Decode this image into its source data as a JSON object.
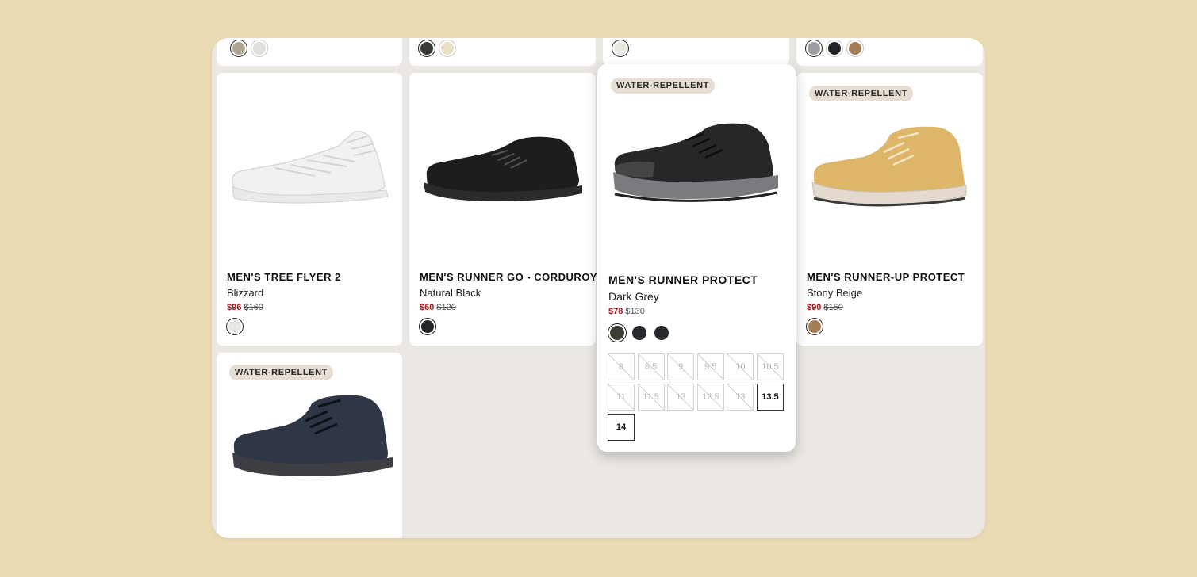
{
  "colors": {
    "page_bg": "#eadbb5",
    "panel_bg": "#ebe8e3",
    "sale_price": "#a4161a",
    "badge_bg": "#e6ded2"
  },
  "top_row": [
    {
      "swatches": [
        "#b1a594",
        "#e2e0dc"
      ]
    },
    {
      "swatches": [
        "#3b3b35",
        "#e8dfc6"
      ]
    },
    {
      "swatches": [
        "#e9ebe3"
      ]
    },
    {
      "swatches": [
        "#9d9ea3",
        "#1f2227",
        "#a47c56"
      ]
    }
  ],
  "products": [
    {
      "title": "MEN'S TREE FLYER 2",
      "color": "Blizzard",
      "sale_price": "$96",
      "original_price": "$160",
      "swatches": [
        "#e6e6e3"
      ]
    },
    {
      "title": "MEN'S RUNNER GO - CORDUROY",
      "color": "Natural Black",
      "sale_price": "$60",
      "original_price": "$120",
      "swatches": [
        "#23262a"
      ]
    },
    {
      "badge": "WATER-REPELLENT",
      "title": "MEN'S RUNNER PROTECT",
      "color": "Dark Grey",
      "sale_price": "$78",
      "original_price": "$130",
      "swatches": [
        "#3b3d35",
        "#25282c",
        "#25282c"
      ],
      "sizes": [
        {
          "label": "8",
          "available": false
        },
        {
          "label": "8.5",
          "available": false
        },
        {
          "label": "9",
          "available": false
        },
        {
          "label": "9.5",
          "available": false
        },
        {
          "label": "10",
          "available": false
        },
        {
          "label": "10.5",
          "available": false
        },
        {
          "label": "11",
          "available": false
        },
        {
          "label": "11.5",
          "available": false
        },
        {
          "label": "12",
          "available": false
        },
        {
          "label": "12.5",
          "available": false
        },
        {
          "label": "13",
          "available": false
        },
        {
          "label": "13.5",
          "available": true
        },
        {
          "label": "14",
          "available": true
        }
      ]
    },
    {
      "badge": "WATER-REPELLENT",
      "title": "MEN'S RUNNER-UP PROTECT",
      "color": "Stony Beige",
      "sale_price": "$90",
      "original_price": "$150",
      "swatches": [
        "#a47c56"
      ]
    },
    {
      "badge": "WATER-REPELLENT"
    }
  ]
}
